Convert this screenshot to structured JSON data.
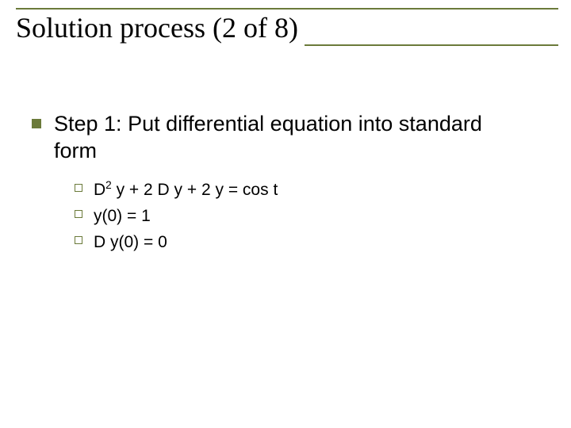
{
  "title": "Solution process (2 of 8)",
  "step": {
    "heading": "Step 1: Put differential equation into standard form",
    "items": [
      {
        "pre": "D",
        "sup": "2",
        "post": " y + 2 D y + 2 y = cos t"
      },
      {
        "pre": "y(0) = 1",
        "sup": "",
        "post": ""
      },
      {
        "pre": "D y(0) = 0",
        "sup": "",
        "post": ""
      }
    ]
  }
}
